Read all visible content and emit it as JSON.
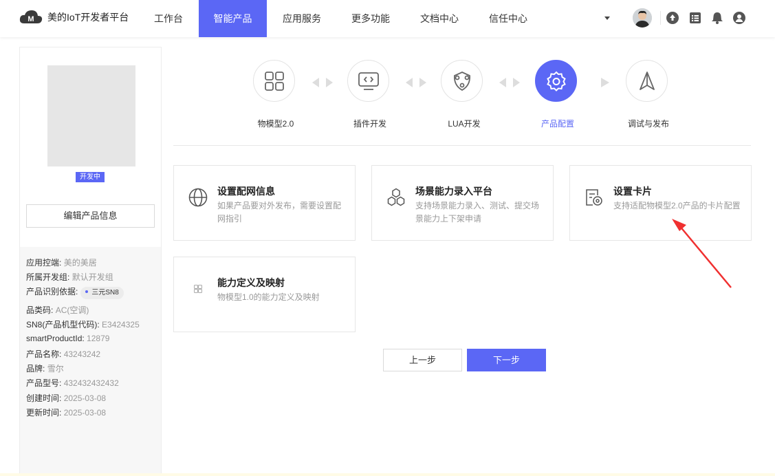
{
  "brand": {
    "name": "美的IoT开发者平台"
  },
  "nav": {
    "items": [
      {
        "label": "工作台",
        "active": false
      },
      {
        "label": "智能产品",
        "active": true
      },
      {
        "label": "应用服务",
        "active": false
      },
      {
        "label": "更多功能",
        "active": false
      },
      {
        "label": "文档中心",
        "active": false
      },
      {
        "label": "信任中心",
        "active": false
      }
    ],
    "icons": [
      "chevron-down-icon",
      "user-avatar",
      "upload-icon",
      "list-icon",
      "bell-icon",
      "user-icon"
    ]
  },
  "product": {
    "status": "开发中",
    "edit_button": "编辑产品信息",
    "info": {
      "control_label": "应用控端:",
      "control_value": "美的美居",
      "group_label": "所属开发组:",
      "group_value": "默认开发组",
      "identify_label": "产品识别依据:",
      "identify_chip": "三元SN8",
      "category_label": "品类码:",
      "category_value": "AC(空调)",
      "sn8_label": "SN8(产品机型代码):",
      "sn8_value": "E3424325",
      "spid_label": "smartProductId:",
      "spid_value": "12879",
      "name_label": "产品名称:",
      "name_value": "43243242",
      "brand_label": "品牌:",
      "brand_value": "雪尔",
      "model_label": "产品型号:",
      "model_value": "432432432432",
      "created_label": "创建时间:",
      "created_value": "2025-03-08",
      "updated_label": "更新时间:",
      "updated_value": "2025-03-08"
    }
  },
  "steps": [
    {
      "label": "物模型2.0",
      "icon": "grid-icon",
      "active": false
    },
    {
      "label": "插件开发",
      "icon": "code-screen-icon",
      "active": false
    },
    {
      "label": "LUA开发",
      "icon": "shield-link-icon",
      "active": false
    },
    {
      "label": "产品配置",
      "icon": "gear-icon",
      "active": true
    },
    {
      "label": "调试与发布",
      "icon": "paper-plane-icon",
      "active": false
    }
  ],
  "cards": [
    {
      "title": "设置配网信息",
      "desc": "如果产品要对外发布，需要设置配网指引",
      "icon": "globe-icon"
    },
    {
      "title": "场景能力录入平台",
      "desc": "支持场景能力录入、测试、提交场景能力上下架申请",
      "icon": "hexagons-icon"
    },
    {
      "title": "设置卡片",
      "desc": "支持适配物模型2.0产品的卡片配置",
      "icon": "card-settings-icon"
    },
    {
      "title": "能力定义及映射",
      "desc": "物模型1.0的能力定义及映射",
      "icon": "small-grid-icon"
    }
  ],
  "actions": {
    "prev": "上一步",
    "next": "下一步"
  },
  "colors": {
    "accent": "#5b67f5",
    "annotation_arrow": "#f03030"
  }
}
